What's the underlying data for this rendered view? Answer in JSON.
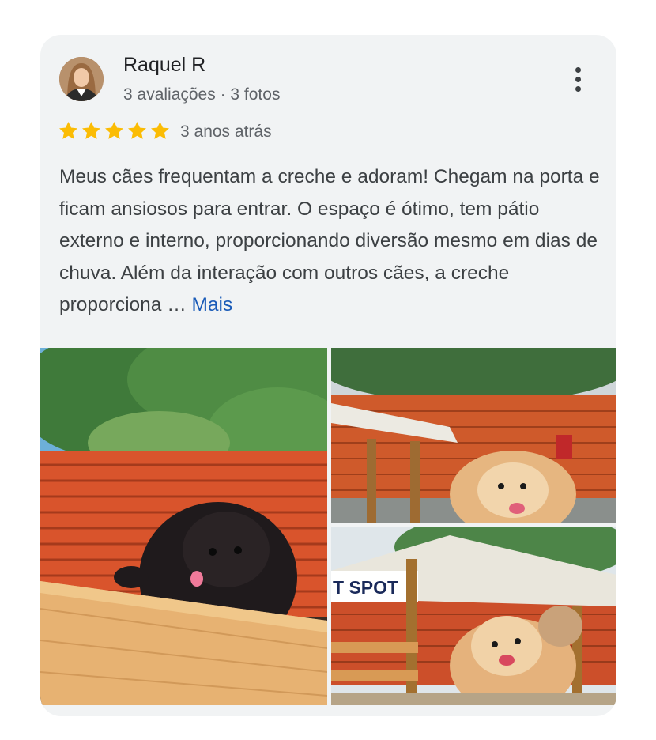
{
  "review": {
    "author_name": "Raquel R",
    "author_meta": "3 avaliações · 3 fotos",
    "rating": 5,
    "rating_max": 5,
    "time_ago": "3 anos atrás",
    "text": "Meus cães frequentam a creche e adoram! Chegam na porta e ficam ansiosos para entrar. O espaço é ótimo, tem pátio externo e interno, proporcionando diversão mesmo em dias de chuva. Além da interação com outros cães, a creche proporciona …",
    "more_label": "Mais",
    "photo_sign_text": "T SPOT",
    "photo_count": 3
  },
  "colors": {
    "star": "#fbbc04",
    "link": "#1a5bb8",
    "card_background": "#f1f3f4",
    "fence": "#d2542a"
  },
  "icons": {
    "menu": "more-vert-icon",
    "rating": "star-icon"
  }
}
